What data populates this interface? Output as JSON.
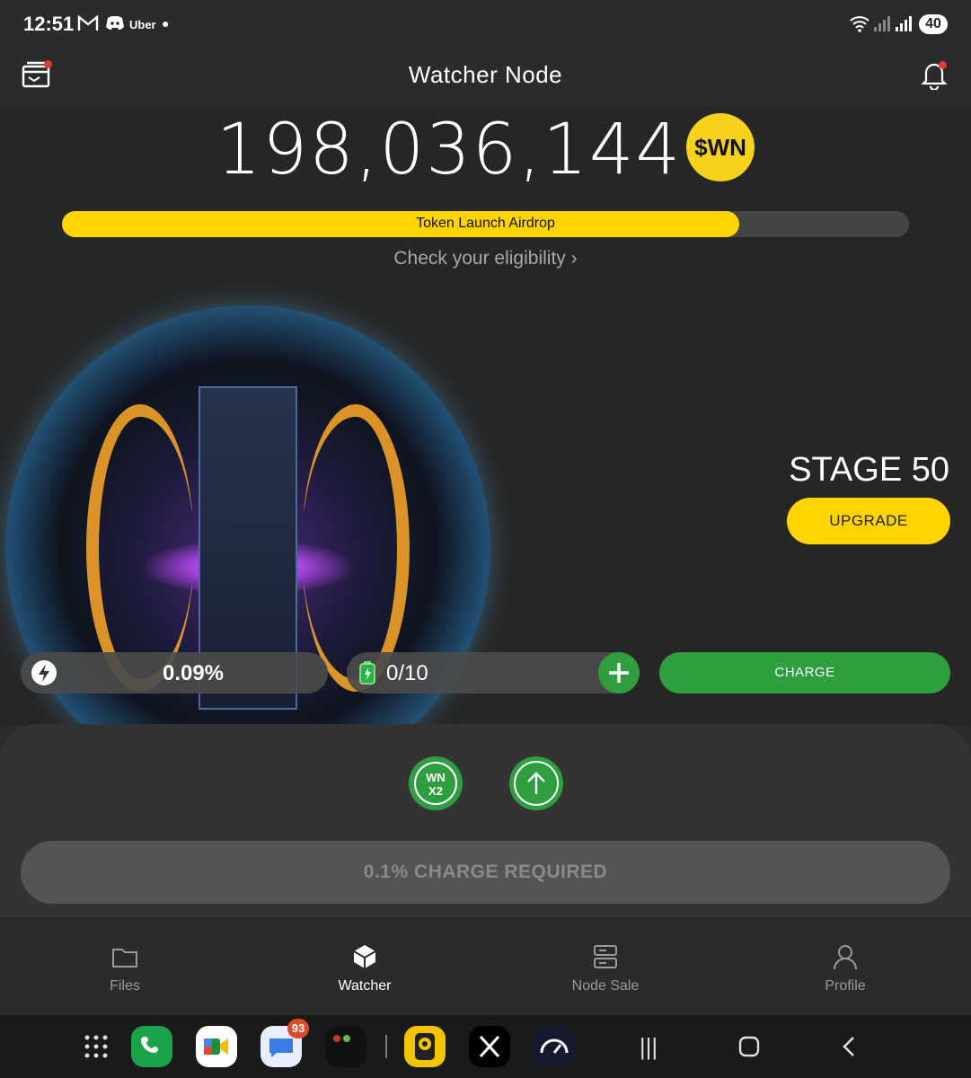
{
  "status_bar": {
    "time": "12:51",
    "notif_app": "Uber",
    "battery": "40"
  },
  "header": {
    "title": "Watcher Node"
  },
  "balance": {
    "amount": "198,036,144",
    "token": "$WN"
  },
  "airdrop": {
    "label": "Token Launch Airdrop",
    "progress_fraction": 0.8,
    "eligibility_link": "Check your eligibility ›"
  },
  "node": {
    "stage": "STAGE 50",
    "upgrade_label": "UPGRADE",
    "charge_percent": "0.09%",
    "batteries": "0/10",
    "charge_label": "CHARGE"
  },
  "boosts": {
    "multiplier_line1": "WN",
    "multiplier_line2": "X2"
  },
  "action": {
    "required_label": "0.1% CHARGE REQUIRED"
  },
  "nav": {
    "items": [
      {
        "label": "Files",
        "icon": "folder-icon"
      },
      {
        "label": "Watcher",
        "icon": "cube-icon",
        "active": true
      },
      {
        "label": "Node Sale",
        "icon": "server-icon"
      },
      {
        "label": "Profile",
        "icon": "user-icon"
      }
    ]
  },
  "dock": {
    "messages_badge": "93"
  },
  "colors": {
    "accent_yellow": "#ffd400",
    "accent_green": "#2e9e3f",
    "background": "#262626"
  }
}
